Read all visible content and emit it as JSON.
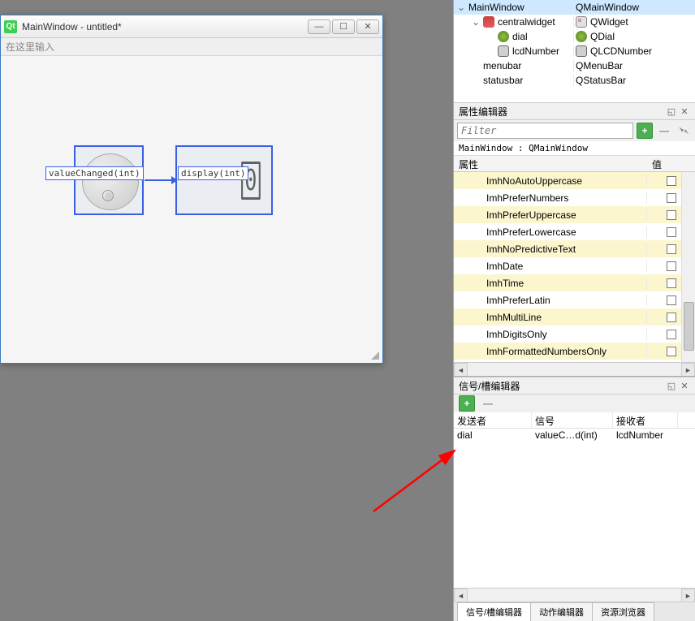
{
  "window": {
    "title": "MainWindow - untitled*",
    "input_placeholder": "在这里输入"
  },
  "signals": {
    "source_signal": "valueChanged(int)",
    "target_slot": "display(int)",
    "lcd_value": "0"
  },
  "object_tree": {
    "rows": [
      {
        "indent": 0,
        "expand": "⌄",
        "name": "MainWindow",
        "class": "QMainWindow",
        "icon": "",
        "selected": true
      },
      {
        "indent": 1,
        "expand": "⌄",
        "name": "centralwidget",
        "class": "QWidget",
        "icon": "ic-window",
        "icon2": "ic-widget"
      },
      {
        "indent": 2,
        "expand": "",
        "name": "dial",
        "class": "QDial",
        "icon": "ic-dial"
      },
      {
        "indent": 2,
        "expand": "",
        "name": "lcdNumber",
        "class": "QLCDNumber",
        "icon": "ic-lcd"
      },
      {
        "indent": 1,
        "expand": "",
        "name": "menubar",
        "class": "QMenuBar",
        "icon": ""
      },
      {
        "indent": 1,
        "expand": "",
        "name": "statusbar",
        "class": "QStatusBar",
        "icon": ""
      }
    ]
  },
  "property_editor": {
    "title": "属性编辑器",
    "filter_placeholder": "Filter",
    "crumb": "MainWindow : QMainWindow",
    "col_property": "属性",
    "col_value": "值",
    "rows": [
      {
        "name": "ImhNoAutoUppercase",
        "alt": true
      },
      {
        "name": "ImhPreferNumbers",
        "alt": false
      },
      {
        "name": "ImhPreferUppercase",
        "alt": true
      },
      {
        "name": "ImhPreferLowercase",
        "alt": false
      },
      {
        "name": "ImhNoPredictiveText",
        "alt": true
      },
      {
        "name": "ImhDate",
        "alt": false
      },
      {
        "name": "ImhTime",
        "alt": true
      },
      {
        "name": "ImhPreferLatin",
        "alt": false
      },
      {
        "name": "ImhMultiLine",
        "alt": true
      },
      {
        "name": "ImhDigitsOnly",
        "alt": false
      },
      {
        "name": "ImhFormattedNumbersOnly",
        "alt": true
      }
    ]
  },
  "signal_editor": {
    "title": "信号/槽编辑器",
    "col_sender": "发送者",
    "col_signal": "信号",
    "col_receiver": "接收者",
    "rows": [
      {
        "sender": "dial",
        "signal": "valueC…d(int)",
        "receiver": "lcdNumber"
      }
    ]
  },
  "tabs": {
    "t1": "信号/槽编辑器",
    "t2": "动作编辑器",
    "t3": "资源浏览器"
  }
}
